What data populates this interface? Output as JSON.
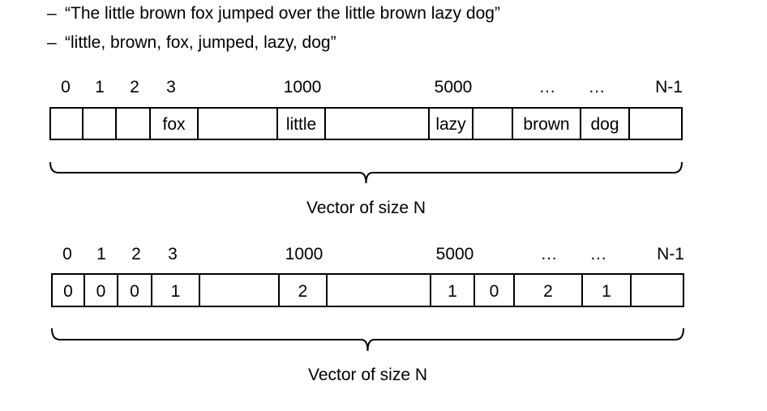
{
  "bullets": [
    "“The little brown fox jumped over the little brown lazy dog”",
    "“little, brown, fox, jumped, lazy, dog”"
  ],
  "bullet_marker": "–",
  "index_labels": [
    "0",
    "1",
    "2",
    "3",
    "1000",
    "5000",
    "…",
    "…",
    "N-1"
  ],
  "vectors": [
    {
      "cells": [
        "",
        "",
        "",
        "fox",
        "",
        "little",
        "",
        "lazy",
        "",
        "brown",
        "dog",
        ""
      ],
      "caption": "Vector of size N"
    },
    {
      "cells": [
        "0",
        "0",
        "0",
        "1",
        "",
        "2",
        "",
        "1",
        "0",
        "2",
        "1",
        ""
      ],
      "caption": "Vector of size N"
    }
  ]
}
